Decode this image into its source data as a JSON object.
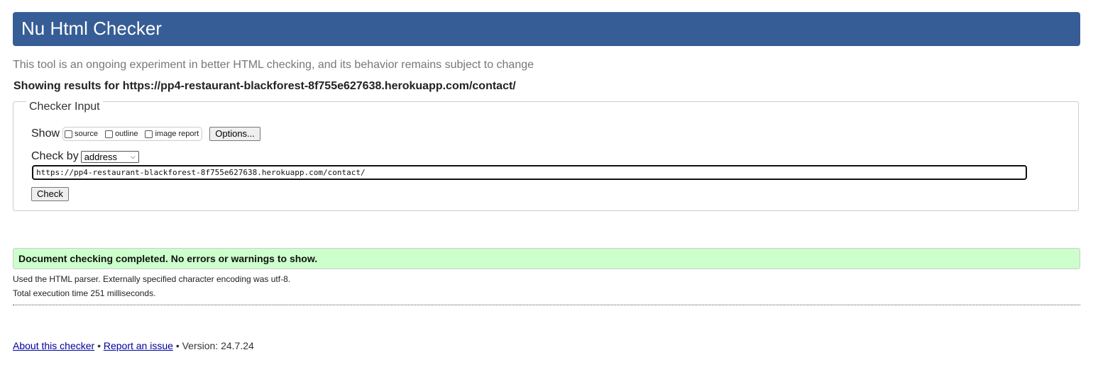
{
  "header": {
    "title": "Nu Html Checker"
  },
  "tagline": "This tool is an ongoing experiment in better HTML checking, and its behavior remains subject to change",
  "showing": {
    "prefix": "Showing results for ",
    "url": "https://pp4-restaurant-blackforest-8f755e627638.herokuapp.com/contact/"
  },
  "checker_input": {
    "legend": "Checker Input",
    "show_label": "Show",
    "checkboxes": [
      {
        "label": "source",
        "checked": false
      },
      {
        "label": "outline",
        "checked": false
      },
      {
        "label": "image report",
        "checked": false
      }
    ],
    "options_button": "Options...",
    "check_by_label": "Check by",
    "check_by_selected": "address",
    "url_value": "https://pp4-restaurant-blackforest-8f755e627638.herokuapp.com/contact/",
    "check_button": "Check"
  },
  "result": {
    "message": "Document checking completed. No errors or warnings to show."
  },
  "notes": {
    "parser": "Used the HTML parser. Externally specified character encoding was utf-8.",
    "time": "Total execution time 251 milliseconds."
  },
  "footer": {
    "about_link": "About this checker",
    "separator": "•",
    "report_link": "Report an issue",
    "version": "Version: 24.7.24"
  }
}
